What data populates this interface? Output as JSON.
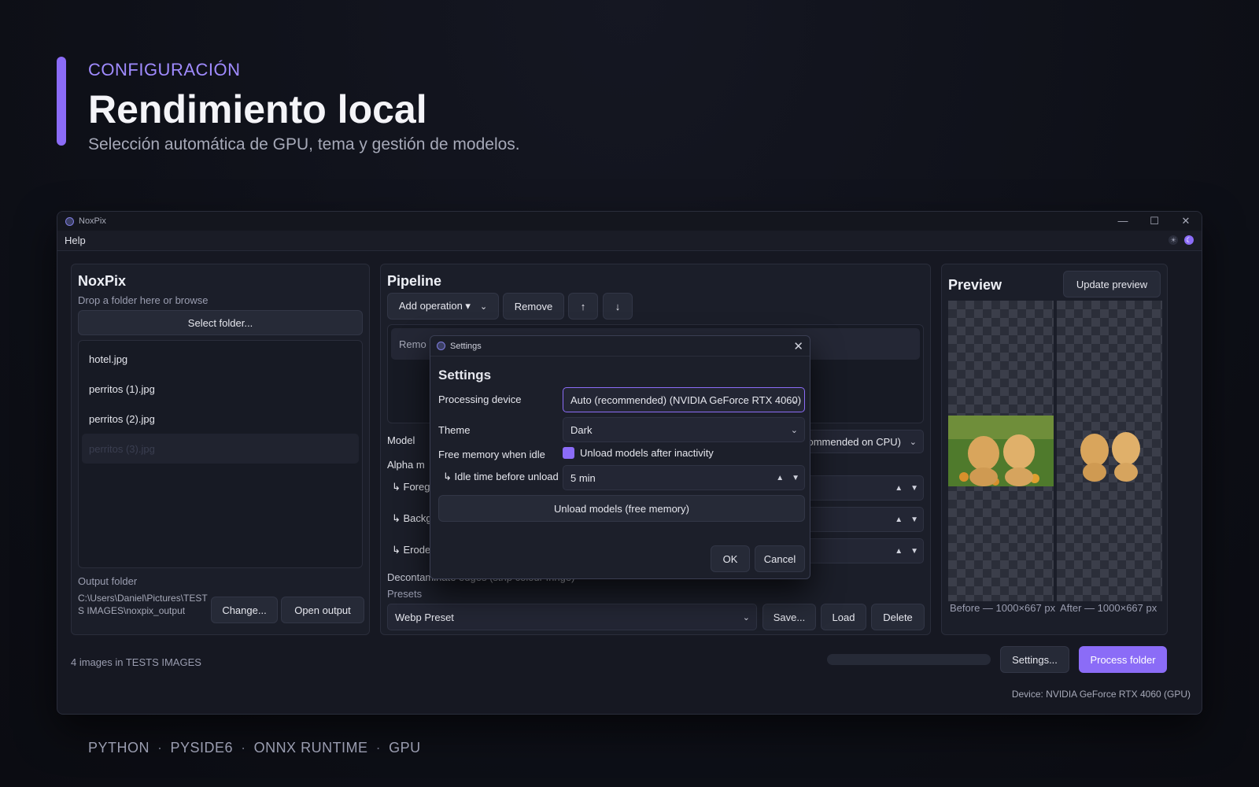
{
  "hero": {
    "eyebrow": "CONFIGURACIÓN",
    "title": "Rendimiento local",
    "subtitle": "Selección automática de GPU, tema y gestión de modelos."
  },
  "footer": {
    "tags": [
      "PYTHON",
      "PYSIDE6",
      "ONNX RUNTIME",
      "GPU"
    ],
    "separator": "·"
  },
  "window": {
    "title": "NoxPix",
    "menu": [
      "Help"
    ],
    "controls": {
      "minimize": "—",
      "maximize": "☐",
      "close": "✕"
    }
  },
  "left_panel": {
    "title": "NoxPix",
    "drop_hint": "Drop a folder here or browse",
    "select_folder": "Select folder...",
    "files": [
      "hotel.jpg",
      "perritos (1).jpg",
      "perritos (2).jpg",
      "perritos (3).jpg"
    ],
    "output_label": "Output folder",
    "output_path": "C:\\Users\\Daniel\\Pictures\\TESTS IMAGES\\noxpix_output",
    "change_btn": "Change...",
    "open_output_btn": "Open output"
  },
  "pipeline": {
    "title": "Pipeline",
    "add_operation": "Add operation ▾",
    "remove": "Remove",
    "up": "↑",
    "down": "↓",
    "list_item_partial": "Remo",
    "model_label": "Model",
    "model_value_partial": "(recommended on CPU)",
    "alpha_label_partial": "Alpha m",
    "fg_label_partial": "↳ Foreg",
    "bg_label_partial": "↳ Backg",
    "erode_label_partial": "↳ Erode",
    "decontaminate": "Decontaminate edges (strip colour fringe)",
    "presets_label": "Presets",
    "preset_value": "Webp Preset",
    "save_btn": "Save...",
    "load_btn": "Load",
    "delete_btn": "Delete"
  },
  "preview": {
    "title": "Preview",
    "update_btn": "Update preview",
    "before_caption": "Before — 1000×667 px",
    "after_caption": "After — 1000×667 px"
  },
  "status": {
    "count": "4 images in TESTS IMAGES",
    "settings_btn": "Settings...",
    "process_btn": "Process folder",
    "device": "Device: NVIDIA GeForce RTX 4060 (GPU)"
  },
  "settings_dialog": {
    "window_title": "Settings",
    "heading": "Settings",
    "device_label": "Processing device",
    "device_value": "Auto (recommended) (NVIDIA GeForce RTX 4060)",
    "theme_label": "Theme",
    "theme_value": "Dark",
    "free_mem_label": "Free memory when idle",
    "unload_checkbox": "Unload models after inactivity",
    "idle_label": "↳ Idle time before unload",
    "idle_value": "5 min",
    "unload_btn": "Unload models (free memory)",
    "ok": "OK",
    "cancel": "Cancel"
  },
  "colors": {
    "accent": "#8b6cf7",
    "background": "#0e1018",
    "panel": "#1b1e29"
  }
}
